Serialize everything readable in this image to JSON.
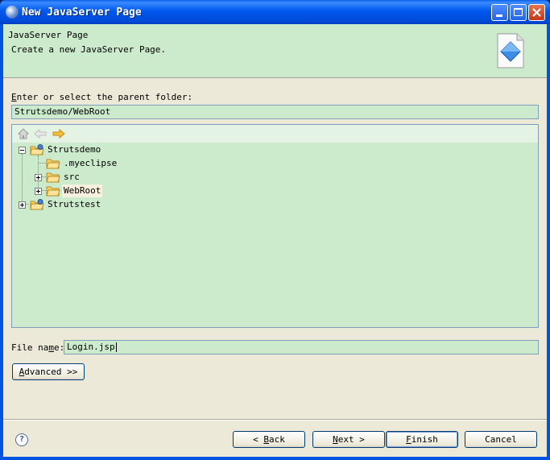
{
  "window": {
    "title": "New JavaServer Page"
  },
  "header": {
    "title": "JavaServer Page",
    "description": "Create a new JavaServer Page."
  },
  "parent_folder": {
    "label_key": "E",
    "label_rest": "nter or select the parent folder:",
    "value": "Strutsdemo/WebRoot"
  },
  "tree": {
    "nodes": [
      {
        "label": "Strutsdemo",
        "type": "project",
        "expanded": true
      },
      {
        "label": ".myeclipse",
        "type": "folder"
      },
      {
        "label": "src",
        "type": "folder",
        "expanded": false
      },
      {
        "label": "WebRoot",
        "type": "folder",
        "expanded": false,
        "selected": true
      },
      {
        "label": "Strutstest",
        "type": "project",
        "expanded": false
      }
    ]
  },
  "file_name": {
    "label_pre": "File na",
    "label_key": "m",
    "label_post": "e:",
    "value": "Login.jsp"
  },
  "buttons": {
    "advanced_key": "A",
    "advanced_rest": "dvanced >>",
    "back_pre": "< ",
    "back_key": "B",
    "back_rest": "ack",
    "next_key": "N",
    "next_rest": "ext >",
    "finish_key": "F",
    "finish_rest": "inish",
    "cancel": "Cancel"
  },
  "colors": {
    "panel_bg": "#ccebcc",
    "dialog_bg": "#ece9d8",
    "titlebar": "#0054e3"
  }
}
